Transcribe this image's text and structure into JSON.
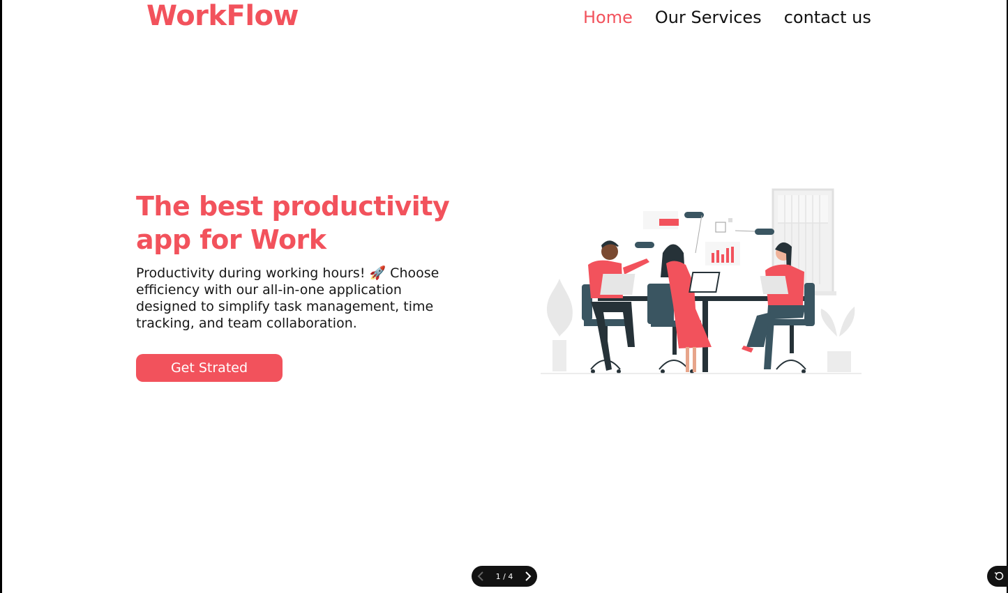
{
  "brand": {
    "logo_text": "WorkFlow",
    "accent_color": "#f2525c"
  },
  "nav": {
    "items": [
      {
        "label": "Home",
        "active": true
      },
      {
        "label": "Our Services",
        "active": false
      },
      {
        "label": "contact us",
        "active": false
      }
    ]
  },
  "hero": {
    "title": "The best productivity app for Work",
    "description": "Productivity during working hours! 🚀 Choose efficiency with our all-in-one application designed to simplify task management, time tracking, and team collaboration.",
    "cta_label": "Get Strated"
  },
  "illustration": {
    "icon": "team-meeting-illustration"
  },
  "pager": {
    "current": 1,
    "total": 4,
    "text": "1 / 4",
    "prev_icon": "chevron-left-icon",
    "next_icon": "chevron-right-icon"
  },
  "reset": {
    "icon": "rotate-ccw-icon"
  }
}
